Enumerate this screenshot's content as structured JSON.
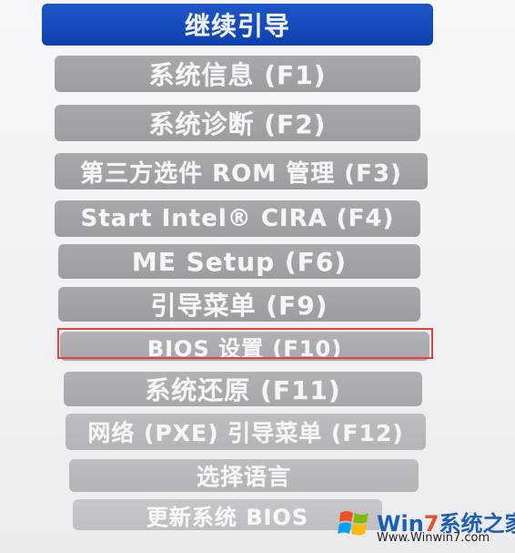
{
  "menu": {
    "items": [
      {
        "label": "继续引导",
        "style": "primary"
      },
      {
        "label": "系统信息 (F1)",
        "style": "normal"
      },
      {
        "label": "系统诊断 (F2)",
        "style": "normal"
      },
      {
        "label": "第三方选件 ROM 管理 (F3)",
        "style": "normal"
      },
      {
        "label": "Start Intel® CIRA (F4)",
        "style": "normal"
      },
      {
        "label": "ME Setup (F6)",
        "style": "normal"
      },
      {
        "label": "引导菜单 (F9)",
        "style": "normal"
      },
      {
        "label": "BIOS 设置 (F10)",
        "style": "normal",
        "highlighted": true
      },
      {
        "label": "系统还原 (F11)",
        "style": "normal"
      },
      {
        "label": "网络 (PXE) 引导菜单 (F12)",
        "style": "normal"
      },
      {
        "label": "选择语言",
        "style": "normal"
      },
      {
        "label": "更新系统 BIOS",
        "style": "normal"
      }
    ]
  },
  "watermark": {
    "title_prefix": "Win",
    "title_num": "7",
    "title_suffix": "系统之家",
    "url": "Www.Winwin7.com"
  },
  "colors": {
    "primary": "#0e41ad",
    "item_gray": "#a3a2a7",
    "highlight_border": "#e6413f"
  }
}
